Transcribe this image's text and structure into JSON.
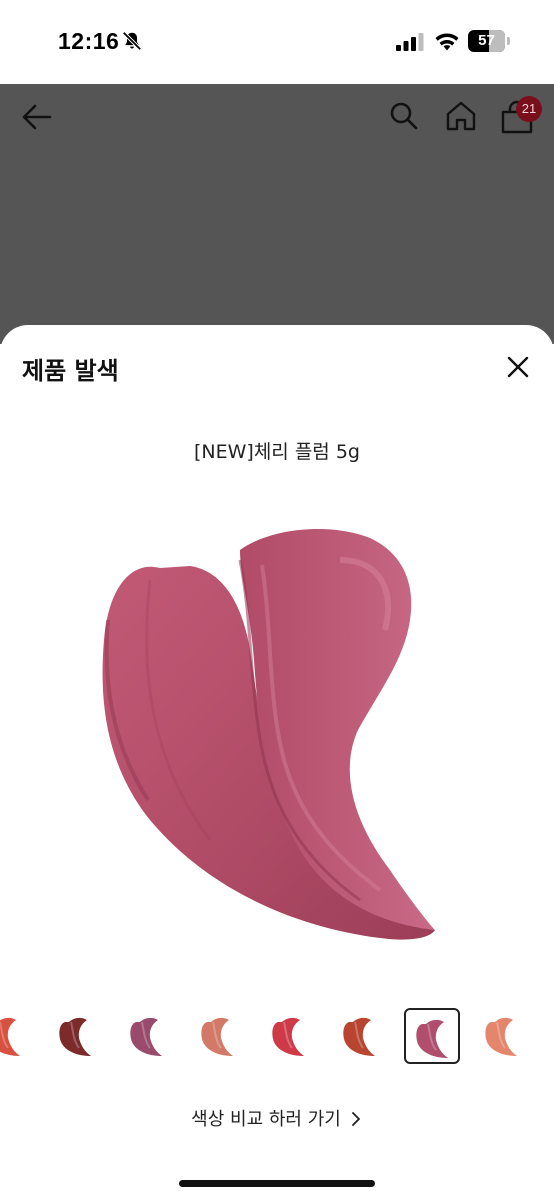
{
  "status_bar": {
    "time": "12:16",
    "battery_level": "57",
    "battery_fraction": 0.57,
    "icons": [
      "bell-slash-icon",
      "cellular-signal-icon",
      "wifi-icon",
      "battery-icon"
    ]
  },
  "header": {
    "icons": [
      "back-arrow-icon",
      "search-icon",
      "home-icon",
      "shopping-bag-icon"
    ],
    "cart_count": "21"
  },
  "sheet": {
    "title": "제품 발색",
    "product_name": "[NEW]체리 플럼 5g",
    "compare_link": "색상 비교 하러 가기",
    "thumbnails": [
      {
        "color": "#d8503f",
        "selected": false
      },
      {
        "color": "#7c2a2a",
        "selected": false
      },
      {
        "color": "#9a4a6a",
        "selected": false
      },
      {
        "color": "#d27a67",
        "selected": false
      },
      {
        "color": "#cf3a48",
        "selected": false
      },
      {
        "color": "#b8452f",
        "selected": false
      },
      {
        "color": "#b04e6e",
        "selected": true
      },
      {
        "color": "#e3866b",
        "selected": false
      }
    ],
    "swatch_color": "#b24d68"
  },
  "colors": {
    "overlay": "#555555",
    "badge": "#7a0f1c"
  }
}
